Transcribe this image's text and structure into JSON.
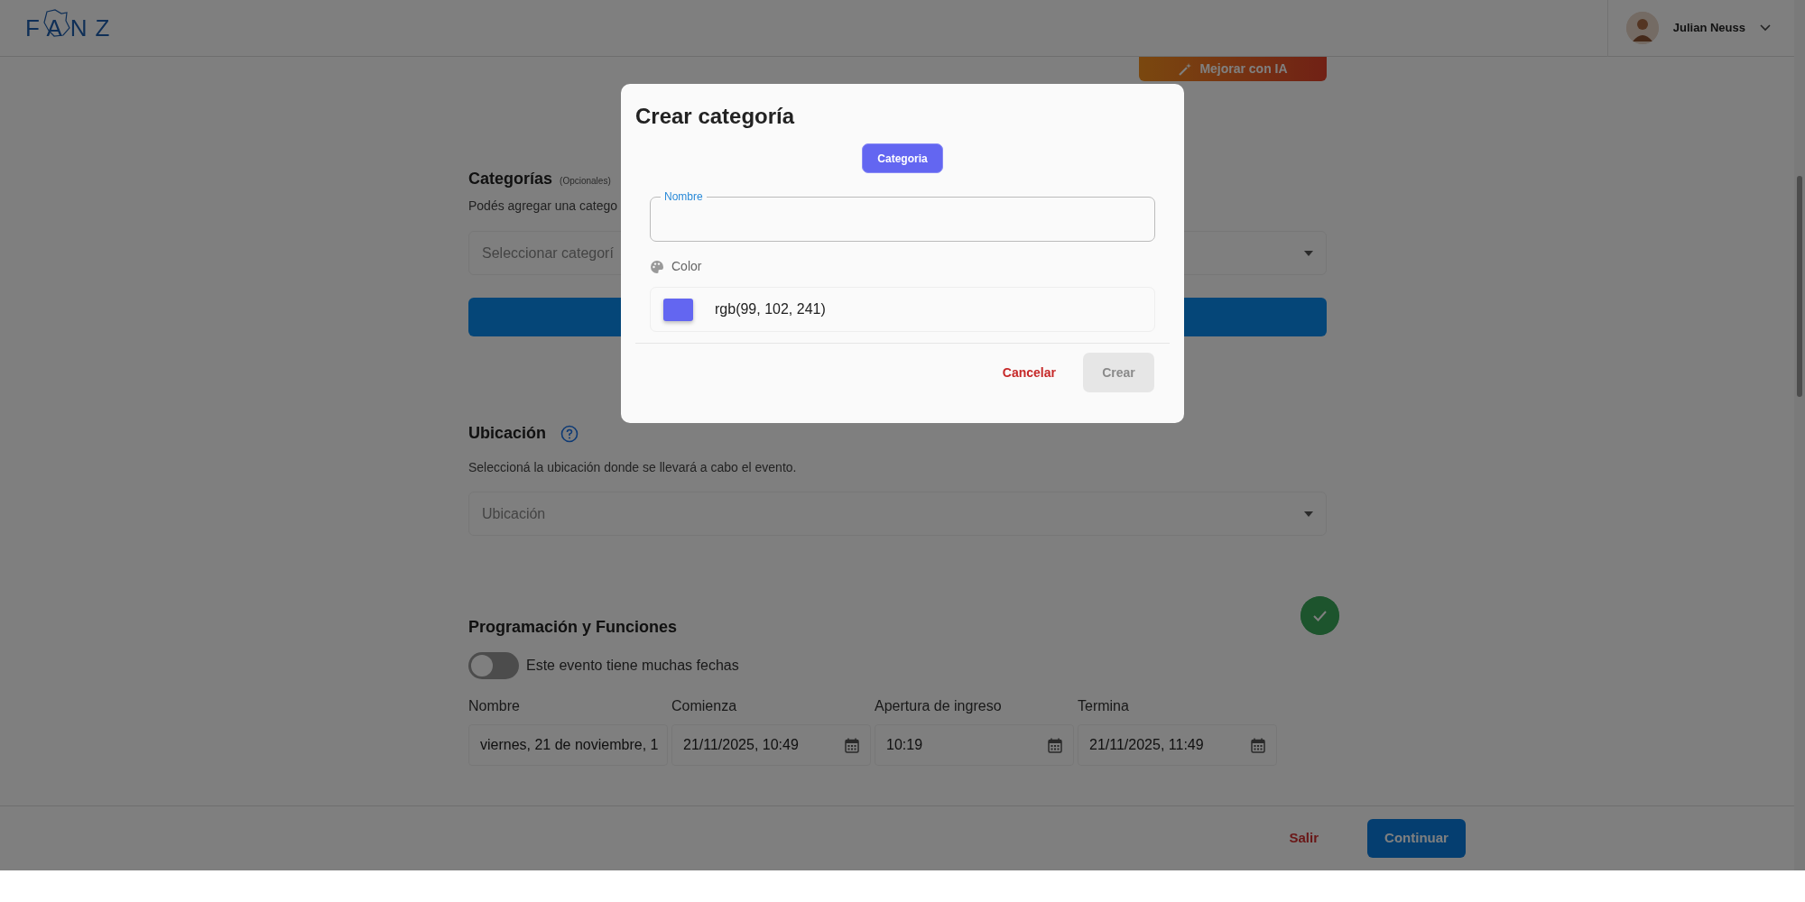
{
  "header": {
    "logo": "FANZ",
    "user_name": "Julian Neuss"
  },
  "ai_button": {
    "label": "Mejorar con IA"
  },
  "categories": {
    "title": "Categorías",
    "optional": "(Opcionales)",
    "description": "Podés agregar una catego",
    "select_placeholder": "Seleccionar categorí"
  },
  "location": {
    "title": "Ubicación",
    "description": "Seleccioná la ubicación donde se llevará a cabo el evento.",
    "select_placeholder": "Ubicación"
  },
  "schedule": {
    "title": "Programación y Funciones",
    "complete": true,
    "toggle": {
      "label": "Este evento tiene muchas fechas",
      "on": false
    },
    "fields": [
      {
        "label": "Nombre",
        "value": "viernes, 21 de noviembre, 1",
        "kind": "text"
      },
      {
        "label": "Comienza",
        "value": "21/11/2025, 10:49",
        "kind": "date"
      },
      {
        "label": "Apertura de ingreso",
        "value": "10:19",
        "kind": "date"
      },
      {
        "label": "Termina",
        "value": "21/11/2025, 11:49",
        "kind": "date"
      }
    ]
  },
  "footer": {
    "buttons": [
      {
        "label": "Salir",
        "kind": "link"
      },
      {
        "label": "Continuar",
        "kind": "primary"
      }
    ]
  },
  "modal": {
    "title": "Crear categoría",
    "chip": "Categoria",
    "name_field": {
      "label": "Nombre"
    },
    "color_label": "Color",
    "color": {
      "text": "rgb(99, 102, 241)",
      "color": "#6366f1"
    },
    "buttons": [
      {
        "label": "Cancelar",
        "kind": "cancel",
        "disabled": false
      },
      {
        "label": "Crear",
        "kind": "primary",
        "disabled": true
      }
    ]
  }
}
